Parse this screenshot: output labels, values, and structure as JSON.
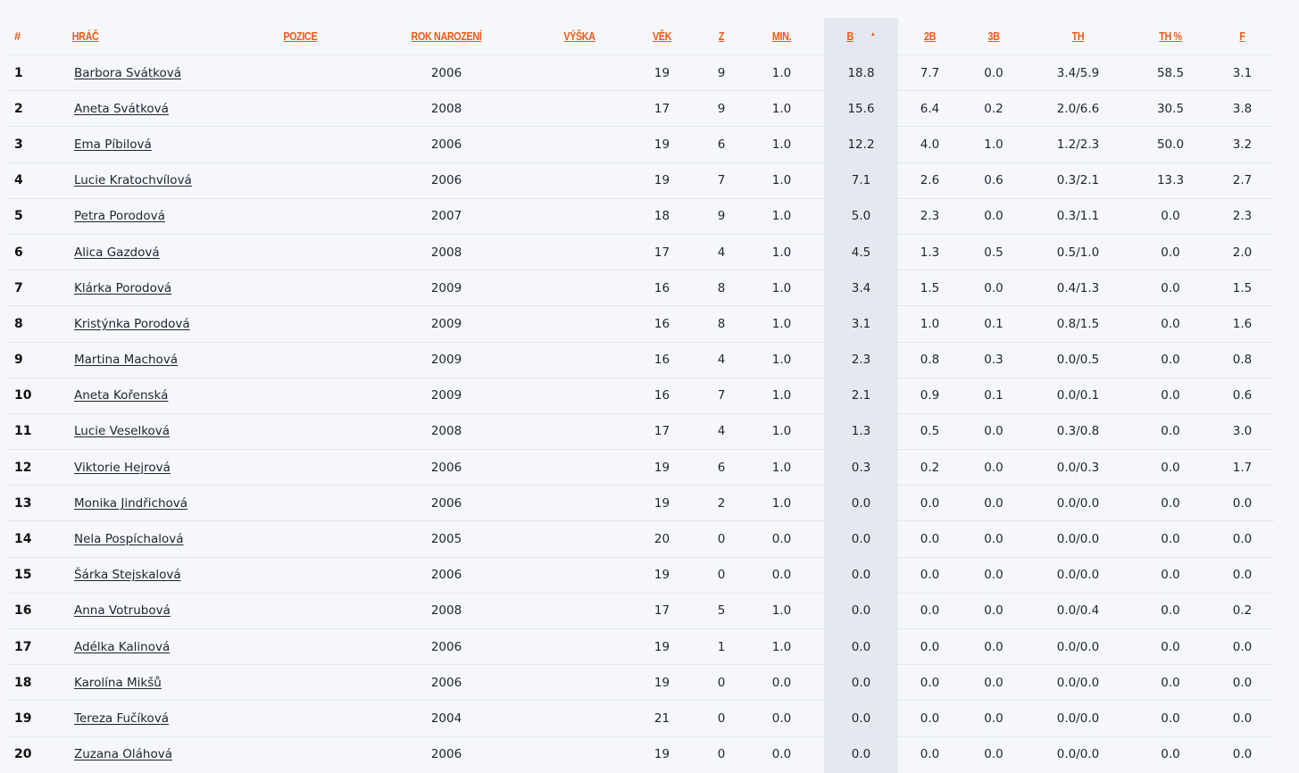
{
  "columns": {
    "rank": "#",
    "player": "HRÁČ",
    "position": "POZICE",
    "birth_year": "ROK NAROZENÍ",
    "height": "VÝŠKA",
    "age": "VĚK",
    "games": "Z",
    "minutes": "MIN.",
    "points": "B",
    "two_pt": "2B",
    "three_pt": "3B",
    "free_throws": "TH",
    "ft_pct": "TH %",
    "fouls": "F"
  },
  "sort": {
    "column": "points",
    "direction": "desc",
    "indicator": "sort-caret-up-icon"
  },
  "accent_color": "#ee5a14",
  "rows": [
    {
      "rank": "1",
      "name": "Barbora Svátková",
      "position": "",
      "birth_year": "2006",
      "height": "",
      "age": "19",
      "games": "9",
      "minutes": "1.0",
      "points": "18.8",
      "two_pt": "7.7",
      "three_pt": "0.0",
      "free_throws": "3.4/5.9",
      "ft_pct": "58.5",
      "fouls": "3.1"
    },
    {
      "rank": "2",
      "name": "Aneta Svátková",
      "position": "",
      "birth_year": "2008",
      "height": "",
      "age": "17",
      "games": "9",
      "minutes": "1.0",
      "points": "15.6",
      "two_pt": "6.4",
      "three_pt": "0.2",
      "free_throws": "2.0/6.6",
      "ft_pct": "30.5",
      "fouls": "3.8"
    },
    {
      "rank": "3",
      "name": "Ema Píbilová",
      "position": "",
      "birth_year": "2006",
      "height": "",
      "age": "19",
      "games": "6",
      "minutes": "1.0",
      "points": "12.2",
      "two_pt": "4.0",
      "three_pt": "1.0",
      "free_throws": "1.2/2.3",
      "ft_pct": "50.0",
      "fouls": "3.2"
    },
    {
      "rank": "4",
      "name": "Lucie Kratochvílová",
      "position": "",
      "birth_year": "2006",
      "height": "",
      "age": "19",
      "games": "7",
      "minutes": "1.0",
      "points": "7.1",
      "two_pt": "2.6",
      "three_pt": "0.6",
      "free_throws": "0.3/2.1",
      "ft_pct": "13.3",
      "fouls": "2.7"
    },
    {
      "rank": "5",
      "name": "Petra Porodová",
      "position": "",
      "birth_year": "2007",
      "height": "",
      "age": "18",
      "games": "9",
      "minutes": "1.0",
      "points": "5.0",
      "two_pt": "2.3",
      "three_pt": "0.0",
      "free_throws": "0.3/1.1",
      "ft_pct": "0.0",
      "fouls": "2.3"
    },
    {
      "rank": "6",
      "name": "Alica Gazdová",
      "position": "",
      "birth_year": "2008",
      "height": "",
      "age": "17",
      "games": "4",
      "minutes": "1.0",
      "points": "4.5",
      "two_pt": "1.3",
      "three_pt": "0.5",
      "free_throws": "0.5/1.0",
      "ft_pct": "0.0",
      "fouls": "2.0"
    },
    {
      "rank": "7",
      "name": "Klárka Porodová",
      "position": "",
      "birth_year": "2009",
      "height": "",
      "age": "16",
      "games": "8",
      "minutes": "1.0",
      "points": "3.4",
      "two_pt": "1.5",
      "three_pt": "0.0",
      "free_throws": "0.4/1.3",
      "ft_pct": "0.0",
      "fouls": "1.5"
    },
    {
      "rank": "8",
      "name": "Kristýnka Porodová",
      "position": "",
      "birth_year": "2009",
      "height": "",
      "age": "16",
      "games": "8",
      "minutes": "1.0",
      "points": "3.1",
      "two_pt": "1.0",
      "three_pt": "0.1",
      "free_throws": "0.8/1.5",
      "ft_pct": "0.0",
      "fouls": "1.6"
    },
    {
      "rank": "9",
      "name": "Martina Machová",
      "position": "",
      "birth_year": "2009",
      "height": "",
      "age": "16",
      "games": "4",
      "minutes": "1.0",
      "points": "2.3",
      "two_pt": "0.8",
      "three_pt": "0.3",
      "free_throws": "0.0/0.5",
      "ft_pct": "0.0",
      "fouls": "0.8"
    },
    {
      "rank": "10",
      "name": "Aneta Kořenská",
      "position": "",
      "birth_year": "2009",
      "height": "",
      "age": "16",
      "games": "7",
      "minutes": "1.0",
      "points": "2.1",
      "two_pt": "0.9",
      "three_pt": "0.1",
      "free_throws": "0.0/0.1",
      "ft_pct": "0.0",
      "fouls": "0.6"
    },
    {
      "rank": "11",
      "name": "Lucie Veselková",
      "position": "",
      "birth_year": "2008",
      "height": "",
      "age": "17",
      "games": "4",
      "minutes": "1.0",
      "points": "1.3",
      "two_pt": "0.5",
      "three_pt": "0.0",
      "free_throws": "0.3/0.8",
      "ft_pct": "0.0",
      "fouls": "3.0"
    },
    {
      "rank": "12",
      "name": "Viktorie Hejrová",
      "position": "",
      "birth_year": "2006",
      "height": "",
      "age": "19",
      "games": "6",
      "minutes": "1.0",
      "points": "0.3",
      "two_pt": "0.2",
      "three_pt": "0.0",
      "free_throws": "0.0/0.3",
      "ft_pct": "0.0",
      "fouls": "1.7"
    },
    {
      "rank": "13",
      "name": "Monika Jindřichová",
      "position": "",
      "birth_year": "2006",
      "height": "",
      "age": "19",
      "games": "2",
      "minutes": "1.0",
      "points": "0.0",
      "two_pt": "0.0",
      "three_pt": "0.0",
      "free_throws": "0.0/0.0",
      "ft_pct": "0.0",
      "fouls": "0.0"
    },
    {
      "rank": "14",
      "name": "Nela Pospíchalová",
      "position": "",
      "birth_year": "2005",
      "height": "",
      "age": "20",
      "games": "0",
      "minutes": "0.0",
      "points": "0.0",
      "two_pt": "0.0",
      "three_pt": "0.0",
      "free_throws": "0.0/0.0",
      "ft_pct": "0.0",
      "fouls": "0.0"
    },
    {
      "rank": "15",
      "name": "Šárka Stejskalová",
      "position": "",
      "birth_year": "2006",
      "height": "",
      "age": "19",
      "games": "0",
      "minutes": "0.0",
      "points": "0.0",
      "two_pt": "0.0",
      "three_pt": "0.0",
      "free_throws": "0.0/0.0",
      "ft_pct": "0.0",
      "fouls": "0.0"
    },
    {
      "rank": "16",
      "name": "Anna Votrubová",
      "position": "",
      "birth_year": "2008",
      "height": "",
      "age": "17",
      "games": "5",
      "minutes": "1.0",
      "points": "0.0",
      "two_pt": "0.0",
      "three_pt": "0.0",
      "free_throws": "0.0/0.4",
      "ft_pct": "0.0",
      "fouls": "0.2"
    },
    {
      "rank": "17",
      "name": "Adélka Kalinová",
      "position": "",
      "birth_year": "2006",
      "height": "",
      "age": "19",
      "games": "1",
      "minutes": "1.0",
      "points": "0.0",
      "two_pt": "0.0",
      "three_pt": "0.0",
      "free_throws": "0.0/0.0",
      "ft_pct": "0.0",
      "fouls": "0.0"
    },
    {
      "rank": "18",
      "name": "Karolína Mikšů",
      "position": "",
      "birth_year": "2006",
      "height": "",
      "age": "19",
      "games": "0",
      "minutes": "0.0",
      "points": "0.0",
      "two_pt": "0.0",
      "three_pt": "0.0",
      "free_throws": "0.0/0.0",
      "ft_pct": "0.0",
      "fouls": "0.0"
    },
    {
      "rank": "19",
      "name": "Tereza Fučíková",
      "position": "",
      "birth_year": "2004",
      "height": "",
      "age": "21",
      "games": "0",
      "minutes": "0.0",
      "points": "0.0",
      "two_pt": "0.0",
      "three_pt": "0.0",
      "free_throws": "0.0/0.0",
      "ft_pct": "0.0",
      "fouls": "0.0"
    },
    {
      "rank": "20",
      "name": "Zuzana Oláhová",
      "position": "",
      "birth_year": "2006",
      "height": "",
      "age": "19",
      "games": "0",
      "minutes": "0.0",
      "points": "0.0",
      "two_pt": "0.0",
      "three_pt": "0.0",
      "free_throws": "0.0/0.0",
      "ft_pct": "0.0",
      "fouls": "0.0"
    }
  ]
}
